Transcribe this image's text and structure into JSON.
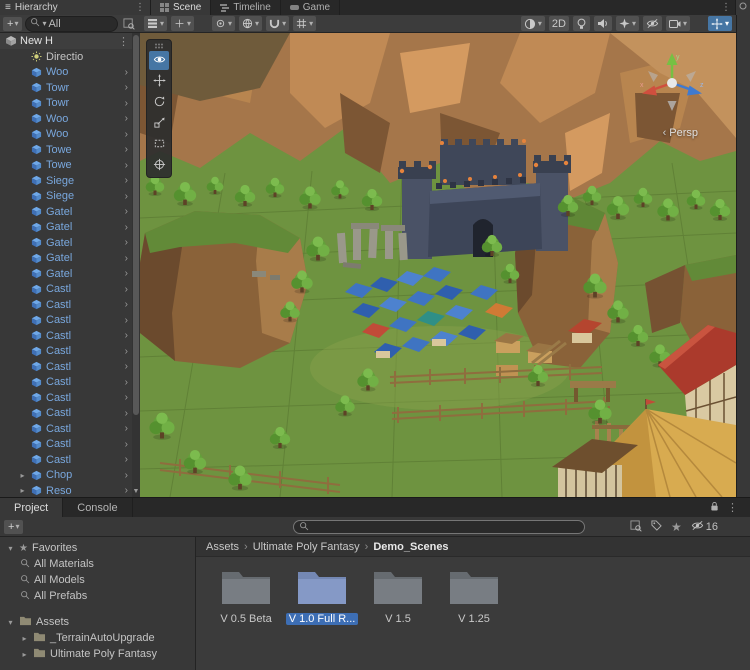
{
  "colors": {
    "accent_blue": "#4676a4",
    "selection_blue": "#3d6eb4",
    "prefab_text": "#79a7dd"
  },
  "icons": {
    "menu": "≡",
    "kebab": "⋮",
    "caret": "▾",
    "expander": "▸",
    "open_arrow": "›",
    "breadcrumb_sep": "›",
    "persp_arrow": "‹",
    "star": "★",
    "scroll_down": "▼",
    "plus": "+"
  },
  "top_tabs": {
    "hierarchy": "Hierarchy",
    "scene": "Scene",
    "timeline": "Timeline",
    "game": "Game"
  },
  "hierarchy": {
    "add_label": "+",
    "search_value": "All",
    "scene_name": "New H",
    "items": [
      {
        "label": "Directio",
        "kind": "light",
        "expander": false
      },
      {
        "label": "Woo",
        "kind": "prefab",
        "expander": false
      },
      {
        "label": "Towr",
        "kind": "prefab",
        "expander": false
      },
      {
        "label": "Towr",
        "kind": "prefab",
        "expander": false
      },
      {
        "label": "Woo",
        "kind": "prefab",
        "expander": false
      },
      {
        "label": "Woo",
        "kind": "prefab",
        "expander": false
      },
      {
        "label": "Towe",
        "kind": "prefab",
        "expander": false
      },
      {
        "label": "Towe",
        "kind": "prefab",
        "expander": false
      },
      {
        "label": "Siege",
        "kind": "prefab",
        "expander": false
      },
      {
        "label": "Siege",
        "kind": "prefab",
        "expander": false
      },
      {
        "label": "Gatel",
        "kind": "prefab",
        "expander": false
      },
      {
        "label": "Gatel",
        "kind": "prefab",
        "expander": false
      },
      {
        "label": "Gatel",
        "kind": "prefab",
        "expander": false
      },
      {
        "label": "Gatel",
        "kind": "prefab",
        "expander": false
      },
      {
        "label": "Gatel",
        "kind": "prefab",
        "expander": false
      },
      {
        "label": "Castl",
        "kind": "prefab",
        "expander": false
      },
      {
        "label": "Castl",
        "kind": "prefab",
        "expander": false
      },
      {
        "label": "Castl",
        "kind": "prefab",
        "expander": false
      },
      {
        "label": "Castl",
        "kind": "prefab",
        "expander": false
      },
      {
        "label": "Castl",
        "kind": "prefab",
        "expander": false
      },
      {
        "label": "Castl",
        "kind": "prefab",
        "expander": false
      },
      {
        "label": "Castl",
        "kind": "prefab",
        "expander": false
      },
      {
        "label": "Castl",
        "kind": "prefab",
        "expander": false
      },
      {
        "label": "Castl",
        "kind": "prefab",
        "expander": false
      },
      {
        "label": "Castl",
        "kind": "prefab",
        "expander": false
      },
      {
        "label": "Castl",
        "kind": "prefab",
        "expander": false
      },
      {
        "label": "Castl",
        "kind": "prefab",
        "expander": false
      },
      {
        "label": "Chop",
        "kind": "prefab",
        "expander": true
      },
      {
        "label": "Reso",
        "kind": "prefab",
        "expander": true
      }
    ]
  },
  "scene_toolbar": {
    "mode_2d": "2D"
  },
  "scene_view": {
    "projection": "Persp"
  },
  "bottom": {
    "tab_project": "Project",
    "tab_console": "Console",
    "add_label": "+",
    "hidden_count": "16"
  },
  "project_tree": {
    "favorites_label": "Favorites",
    "favorites": [
      "All Materials",
      "All Models",
      "All Prefabs"
    ],
    "assets_label": "Assets",
    "assets_children": [
      "_TerrainAutoUpgrade",
      "Ultimate Poly Fantasy"
    ]
  },
  "breadcrumb": [
    "Assets",
    "Ultimate Poly Fantasy",
    "Demo_Scenes"
  ],
  "folders": [
    {
      "label": "V 0.5 Beta",
      "selected": false
    },
    {
      "label": "V 1.0 Full R...",
      "selected": true
    },
    {
      "label": "V 1.5",
      "selected": false
    },
    {
      "label": "V 1.25",
      "selected": false
    }
  ]
}
